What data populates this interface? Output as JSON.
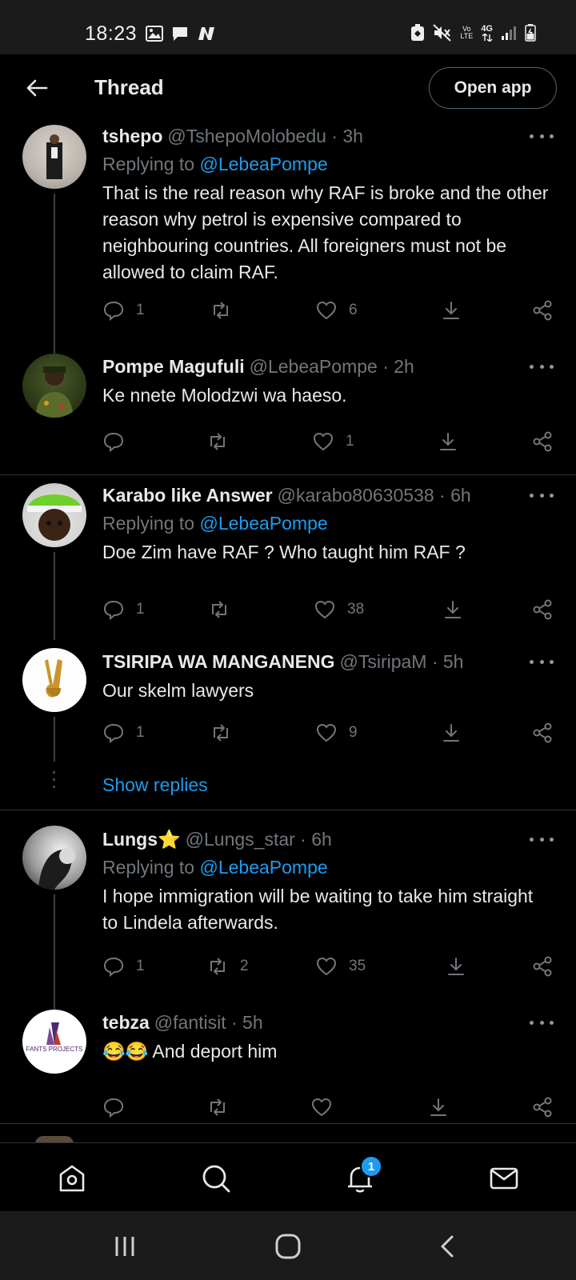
{
  "status_bar": {
    "time": "18:23",
    "left_icons": [
      "gallery-icon",
      "message-icon",
      "n-app-icon"
    ],
    "right_icons": [
      "cleaner-icon",
      "mute-icon",
      "volte-icon",
      "4g-icon",
      "signal-icon",
      "battery-charging-icon"
    ],
    "volte_label": "Vo LTE",
    "network_label": "4G"
  },
  "header": {
    "title": "Thread",
    "open_app_label": "Open app"
  },
  "tweets": [
    {
      "name": "tshepo",
      "handle": "@TshepoMolobedu · 3h",
      "replying_prefix": "Replying to ",
      "replying_to": "@LebeaPompe",
      "text": "That is the real reason why RAF is broke and the other reason why petrol is expensive compared to neighbouring countries. All foreigners must not be allowed to claim RAF.",
      "replies": "1",
      "retweets": "",
      "likes": "6"
    },
    {
      "name": "Pompe Magufuli",
      "handle": "@LebeaPompe · 2h",
      "text": "Ke nnete  Molodzwi  wa haeso.",
      "replies": "",
      "retweets": "",
      "likes": "1"
    },
    {
      "name": "Karabo like Answer",
      "handle": "@karabo80630538 · 6h",
      "replying_prefix": "Replying to ",
      "replying_to": "@LebeaPompe",
      "text": "Doe Zim have RAF ? Who taught him RAF ?",
      "replies": "1",
      "retweets": "",
      "likes": "38"
    },
    {
      "name": "TSIRIPA WA MANGANENG",
      "handle": "@TsiripaM · 5h",
      "text": "Our skelm lawyers",
      "replies": "1",
      "retweets": "",
      "likes": "9"
    },
    {
      "name": "Lungs⭐",
      "handle": "@Lungs_star · 6h",
      "replying_prefix": "Replying to ",
      "replying_to": "@LebeaPompe",
      "text": "I hope immigration will be waiting to take him straight to Lindela afterwards.",
      "replies": "1",
      "retweets": "2",
      "likes": "35"
    },
    {
      "name": "tebza",
      "handle": "@fantisit · 5h",
      "text": "😂😂 And deport him",
      "avatar_label": "FANTS PROJECTS",
      "replies": "",
      "retweets": "",
      "likes": ""
    }
  ],
  "show_replies_label": "Show replies",
  "tabbar": {
    "items": [
      "home-icon",
      "search-icon",
      "notifications-icon",
      "messages-icon"
    ],
    "notification_count": "1"
  },
  "system_nav": [
    "recents-button",
    "home-button",
    "back-button"
  ],
  "colors": {
    "background": "#000000",
    "accent": "#1d9bf0",
    "muted": "#71767b",
    "text": "#e7e9ea"
  }
}
